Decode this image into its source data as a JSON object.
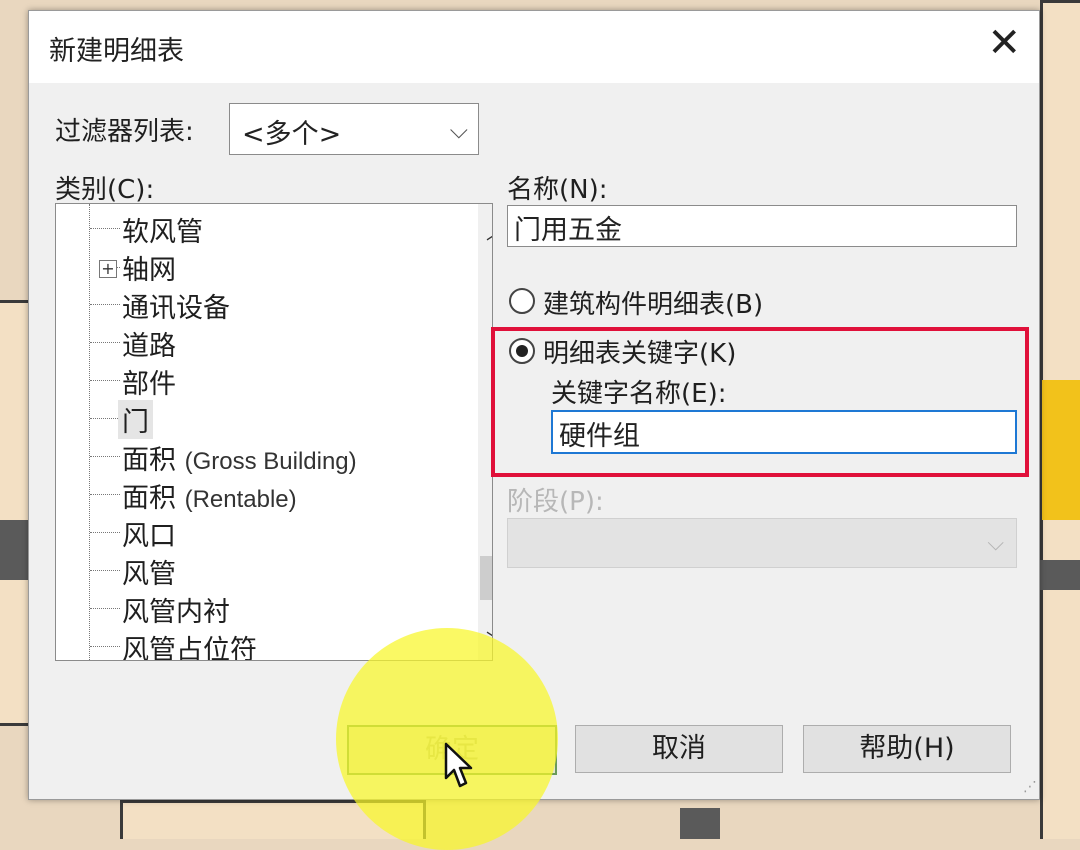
{
  "dialog": {
    "title": "新建明细表",
    "close_symbol": "✕"
  },
  "filter": {
    "label": "过滤器列表:",
    "value": "<多个>"
  },
  "category": {
    "label": "类别(C):",
    "items": [
      "软风管",
      "轴网",
      "通讯设备",
      "道路",
      "部件",
      "门",
      "面积",
      "面积",
      "风口",
      "风管",
      "风管内衬",
      "风管占位符"
    ],
    "item_suffixes": {
      "6": "(Gross Building)",
      "7": "(Rentable)"
    },
    "selected_index": 5
  },
  "name": {
    "label": "名称(N):",
    "value": "门用五金"
  },
  "options": {
    "building_component": "建筑构件明细表(B)",
    "schedule_key": "明细表关键字(K)",
    "key_name_label": "关键字名称(E):",
    "key_name_value": "硬件组",
    "selected": "schedule_key"
  },
  "phase": {
    "label": "阶段(P):",
    "value": ""
  },
  "buttons": {
    "ok": "确定",
    "cancel": "取消",
    "help": "帮助(H)"
  },
  "icons": {
    "dropdown": "chevron-down-icon",
    "expand": "plus-box-icon",
    "cursor": "mouse-pointer-icon"
  },
  "colors": {
    "highlight": "#e0103a",
    "cursor_halo": "#f8f628",
    "focus": "#1e78d4"
  }
}
